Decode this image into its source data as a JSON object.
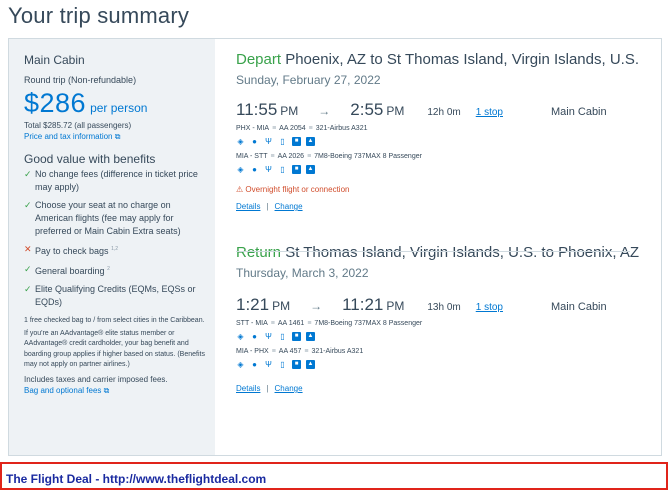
{
  "page_title": "Your trip summary",
  "summary": {
    "cabin": "Main Cabin",
    "trip_type": "Round trip (Non-refundable)",
    "price": "$286",
    "per_person": "per person",
    "total": "Total $285.72 (all passengers)",
    "price_info_link": "Price and tax information",
    "benefits_title": "Good value with benefits",
    "benefits": [
      {
        "status": "included",
        "text": "No change fees (difference in ticket price may apply)",
        "sup": ""
      },
      {
        "status": "included",
        "text": "Choose your seat at no charge on American flights (fee may apply for preferred or Main Cabin Extra seats)",
        "sup": ""
      },
      {
        "status": "excluded",
        "text": "Pay to check bags",
        "sup": "1,2"
      },
      {
        "status": "included",
        "text": "General boarding",
        "sup": "2"
      },
      {
        "status": "included",
        "text": "Elite Qualifying Credits (EQMs, EQSs or EQDs)",
        "sup": ""
      }
    ],
    "footnote_1": "1 free checked bag to / from select cities in the Caribbean.",
    "footnote_2": "If you're an AAdvantage® elite status member or AAdvantage® credit cardholder, your bag benefit and boarding group applies if higher based on status. (Benefits may not apply on partner airlines.)",
    "taxes_note": "Includes taxes and carrier imposed fees.",
    "bag_fees_link": "Bag and optional fees"
  },
  "depart": {
    "keyword": "Depart",
    "route": "Phoenix, AZ to St Thomas Island, Virgin Islands, U.S.",
    "date": "Sunday, February 27, 2022",
    "dep_time": "11:55",
    "dep_ampm": "PM",
    "arr_time": "2:55",
    "arr_ampm": "PM",
    "duration": "12h 0m",
    "stops": "1 stop",
    "cabin": "Main Cabin",
    "segments": [
      {
        "route": "PHX - MIA",
        "flight": "AA 2054",
        "aircraft": "321-Airbus A321"
      },
      {
        "route": "MIA - STT",
        "flight": "AA 2026",
        "aircraft": "7M8-Boeing 737MAX 8 Passenger"
      }
    ],
    "warning": "Overnight flight or connection",
    "details_link": "Details",
    "change_link": "Change"
  },
  "return": {
    "keyword": "Return",
    "route": "St Thomas Island, Virgin Islands, U.S. to Phoenix, AZ",
    "date": "Thursday, March 3, 2022",
    "dep_time": "1:21",
    "dep_ampm": "PM",
    "arr_time": "11:21",
    "arr_ampm": "PM",
    "duration": "13h 0m",
    "stops": "1 stop",
    "cabin": "Main Cabin",
    "segments": [
      {
        "route": "STT - MIA",
        "flight": "AA 1461",
        "aircraft": "7M8-Boeing 737MAX 8 Passenger"
      },
      {
        "route": "MIA - PHX",
        "flight": "AA 457",
        "aircraft": "321-Airbus A321"
      }
    ],
    "details_link": "Details",
    "change_link": "Change"
  },
  "amenity_icons": [
    "wifi-icon",
    "power-icon",
    "usb-icon",
    "phone-icon",
    "entertainment-icon",
    "food-icon"
  ],
  "arrow": "→",
  "separator": "|",
  "banner": "The Flight Deal - http://www.theflightdeal.com",
  "colors": {
    "accent": "#0078d2",
    "green": "#39a24b",
    "warning": "#d14d2c",
    "banner_border": "#e0241a",
    "banner_text": "#1a2aa0"
  }
}
